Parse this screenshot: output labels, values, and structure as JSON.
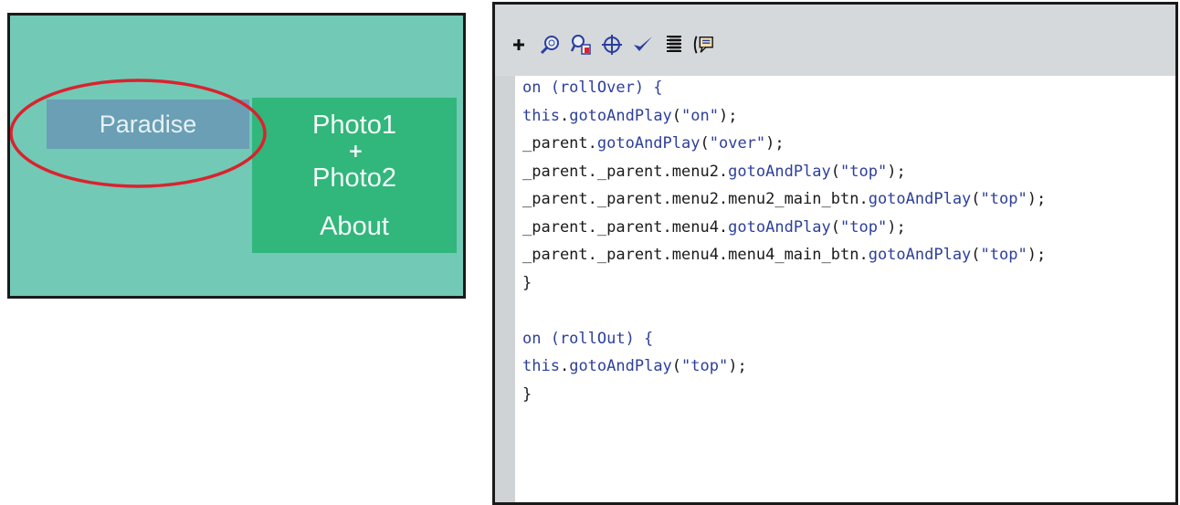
{
  "stage": {
    "menu_button": "Paradise",
    "submenu_items": [
      "Photo1",
      "Photo2",
      "About"
    ],
    "cursor": "+",
    "colors": {
      "background": "#72c9b6",
      "button": "#6a9fb5",
      "submenu": "#31b67c",
      "highlight": "#d9232e"
    }
  },
  "toolbar": {
    "tools": [
      {
        "icon": "add-icon"
      },
      {
        "icon": "find-icon"
      },
      {
        "icon": "replace-icon"
      },
      {
        "icon": "target-path-icon"
      },
      {
        "icon": "check-syntax-icon"
      },
      {
        "icon": "auto-format-icon"
      },
      {
        "icon": "code-hint-icon"
      }
    ]
  },
  "code": {
    "lines": [
      {
        "text": "on (rollOver) {",
        "kind": "kw"
      },
      {
        "text": "this.gotoAndPlay(\"on\");",
        "kind": "code"
      },
      {
        "text": "_parent.gotoAndPlay(\"over\");",
        "kind": "code"
      },
      {
        "text": "_parent._parent.menu2.gotoAndPlay(\"top\");",
        "kind": "code"
      },
      {
        "text": "_parent._parent.menu2.menu2_main_btn.gotoAndPlay(\"top\");",
        "kind": "code"
      },
      {
        "text": "_parent._parent.menu4.gotoAndPlay(\"top\");",
        "kind": "code"
      },
      {
        "text": "_parent._parent.menu4.menu4_main_btn.gotoAndPlay(\"top\");",
        "kind": "code"
      },
      {
        "text": "}",
        "kind": "plain"
      },
      {
        "text": "",
        "kind": "plain"
      },
      {
        "text": "on (rollOut) {",
        "kind": "kw"
      },
      {
        "text": "this.gotoAndPlay(\"top\");",
        "kind": "code"
      },
      {
        "text": "}",
        "kind": "plain"
      }
    ]
  }
}
